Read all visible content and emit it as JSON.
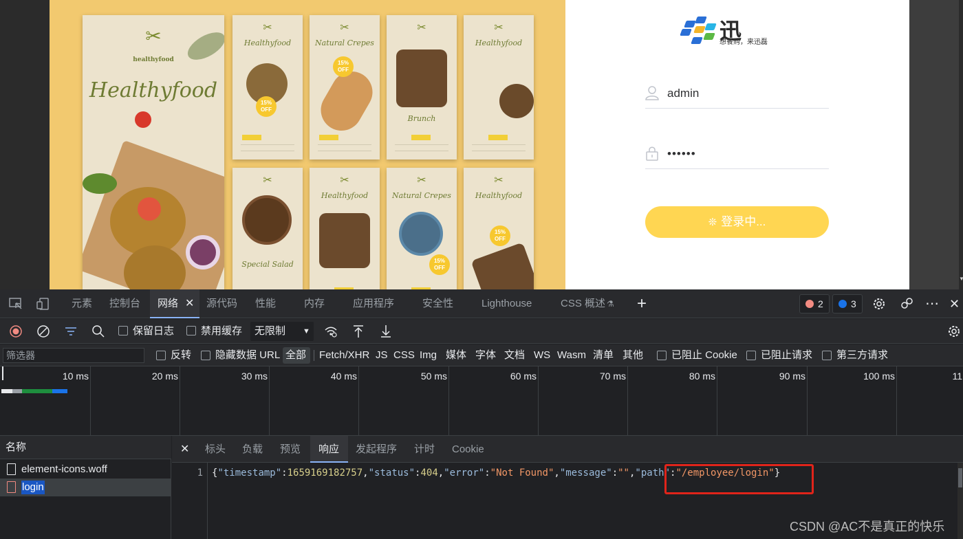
{
  "banner": {
    "main_title": "Healthyfood",
    "logo_text": "healthyfood",
    "posters": [
      {
        "title": "Healthyfood",
        "badge": "15% OFF"
      },
      {
        "title": "Natural Crepes",
        "badge": "15% OFF"
      },
      {
        "title": "Brunch",
        "badge": ""
      },
      {
        "title": "Healthyfood",
        "badge": ""
      },
      {
        "title": "Special Salad",
        "badge": ""
      },
      {
        "title": "Healthyfood",
        "badge": ""
      },
      {
        "title": "Natural Crepes",
        "badge": "15% OFF"
      },
      {
        "title": "Healthyfood",
        "badge": "15% OFF"
      }
    ]
  },
  "login": {
    "logo_text": "迅",
    "logo_slogan": "想餐购，来迅磊",
    "username": "admin",
    "password_mask": "••••••",
    "button_label": "登录中...",
    "icons": {
      "user": "user-icon",
      "lock": "lock-icon",
      "spinner": "loading-spinner-icon"
    },
    "colors": {
      "button": "#ffd652"
    }
  },
  "devtools": {
    "tabs": [
      "元素",
      "控制台",
      "网络",
      "源代码",
      "性能",
      "内存",
      "应用程序",
      "安全性",
      "Lighthouse",
      "CSS 概述"
    ],
    "active_tab": "网络",
    "error_count": "2",
    "message_count": "3",
    "toolbar": {
      "preserve_log": "保留日志",
      "disable_cache": "禁用缓存",
      "throttling": "无限制"
    },
    "filter": {
      "placeholder": "筛选器",
      "invert": "反转",
      "hide_data_urls": "隐藏数据 URL",
      "types": [
        "全部",
        "Fetch/XHR",
        "JS",
        "CSS",
        "Img",
        "媒体",
        "字体",
        "文档",
        "WS",
        "Wasm",
        "清单",
        "其他"
      ],
      "blocked_cookies": "已阻止 Cookie",
      "blocked_requests": "已阻止请求",
      "third_party": "第三方请求"
    },
    "timeline": {
      "ticks": [
        "10 ms",
        "20 ms",
        "30 ms",
        "40 ms",
        "50 ms",
        "60 ms",
        "70 ms",
        "80 ms",
        "90 ms",
        "100 ms",
        "11"
      ]
    },
    "requests": {
      "header": "名称",
      "items": [
        "element-icons.woff",
        "login"
      ]
    },
    "detail": {
      "tabs": [
        "标头",
        "负载",
        "预览",
        "响应",
        "发起程序",
        "计时",
        "Cookie"
      ],
      "active_tab": "响应",
      "line_number": "1",
      "response": {
        "timestamp": "1659169182757",
        "status": "404",
        "error": "\"Not Found\"",
        "message": "\"\"",
        "path": "\"/employee/login\""
      }
    }
  },
  "watermark": "CSDN @AC不是真正的快乐"
}
